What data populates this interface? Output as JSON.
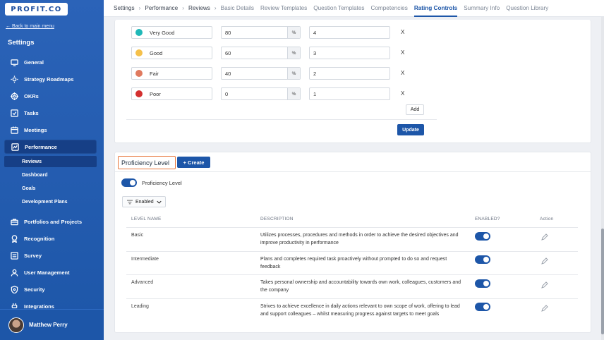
{
  "brand": {
    "logo": "PROFIT.CO"
  },
  "sidebar": {
    "back_link": "← Back to main menu",
    "title": "Settings",
    "items": [
      {
        "label": "General",
        "icon": "monitor-icon"
      },
      {
        "label": "Strategy Roadmaps",
        "icon": "bulb-icon"
      },
      {
        "label": "OKRs",
        "icon": "target-icon"
      },
      {
        "label": "Tasks",
        "icon": "checkbox-icon"
      },
      {
        "label": "Meetings",
        "icon": "calendar-icon"
      },
      {
        "label": "Performance",
        "icon": "chart-icon"
      },
      {
        "label": "Portfolios and Projects",
        "icon": "briefcase-icon"
      },
      {
        "label": "Recognition",
        "icon": "award-icon"
      },
      {
        "label": "Survey",
        "icon": "survey-icon"
      },
      {
        "label": "User Management",
        "icon": "user-icon"
      },
      {
        "label": "Security",
        "icon": "shield-icon"
      },
      {
        "label": "Integrations",
        "icon": "plug-icon"
      }
    ],
    "sub_items": [
      "Reviews",
      "Dashboard",
      "Goals",
      "Development Plans"
    ]
  },
  "user": {
    "name": "Matthew Perry"
  },
  "breadcrumb": [
    "Settings",
    "Performance",
    "Reviews"
  ],
  "tabs": [
    "Basic Details",
    "Review Templates",
    "Question Templates",
    "Competencies",
    "Rating Controls",
    "Summary Info",
    "Question Library"
  ],
  "active_tab": "Rating Controls",
  "rating_rows": [
    {
      "name": "Very Good",
      "color": "#1fb8b8",
      "percent": "80",
      "score": "4"
    },
    {
      "name": "Good",
      "color": "#f5c04a",
      "percent": "60",
      "score": "3"
    },
    {
      "name": "Fair",
      "color": "#e07a5f",
      "percent": "40",
      "score": "2"
    },
    {
      "name": "Poor",
      "color": "#d32f2f",
      "percent": "0",
      "score": "1"
    }
  ],
  "pct_symbol": "%",
  "delete_symbol": "X",
  "add_label": "Add",
  "update_label": "Update",
  "proficiency": {
    "title": "Proficiency Level",
    "create_label": "+ Create",
    "toggle_label": "Proficiency Level",
    "toggle_on": true,
    "filter_label": "Enabled",
    "columns": [
      "LEVEL NAME",
      "DESCRIPTION",
      "ENABLED?",
      "Action"
    ],
    "rows": [
      {
        "name": "Basic",
        "description": "Utilizes processes, procedures and methods in order to achieve the desired objectives and improve productivity in performance",
        "enabled": true
      },
      {
        "name": "Intermediate",
        "description": "Plans and completes required task proactively without prompted to do so and request feedback",
        "enabled": true
      },
      {
        "name": "Advanced",
        "description": "Takes personal ownership and accountability towards own work, colleagues, customers and the company",
        "enabled": true
      },
      {
        "name": "Leading",
        "description": "Strives to achieve excellence in daily actions relevant to own scope of work, offering to lead and support colleagues – whilst measuring progress against targets to meet goals",
        "enabled": true
      }
    ]
  },
  "colors": {
    "accent": "#1d56a8",
    "highlight": "#e8753a"
  }
}
